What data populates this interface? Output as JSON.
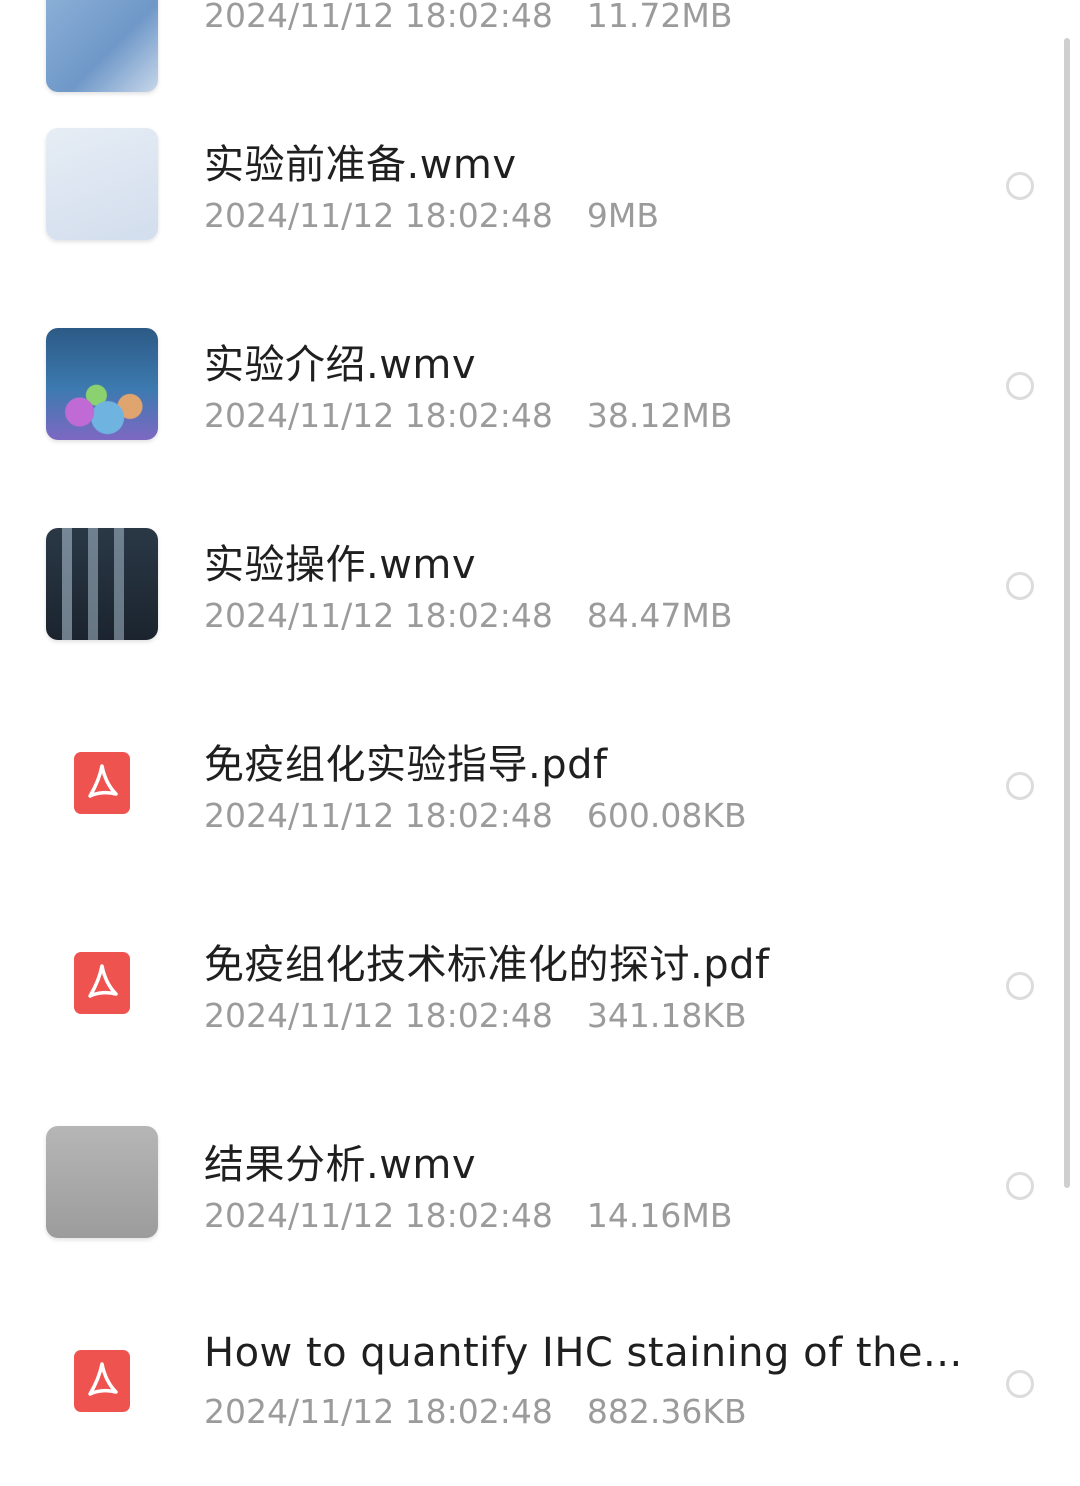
{
  "files": [
    {
      "name": "",
      "date": "2024/11/12 18:02:48",
      "size": "11.72MB",
      "thumb": "video-thumbnail-blue"
    },
    {
      "name": "实验前准备.wmv",
      "date": "2024/11/12 18:02:48",
      "size": "9MB",
      "thumb": "video-thumbnail-light"
    },
    {
      "name": "实验介绍.wmv",
      "date": "2024/11/12 18:02:48",
      "size": "38.12MB",
      "thumb": "video-thumbnail-cells"
    },
    {
      "name": "实验操作.wmv",
      "date": "2024/11/12 18:02:48",
      "size": "84.47MB",
      "thumb": "video-thumbnail-dark"
    },
    {
      "name": "免疫组化实验指导.pdf",
      "date": "2024/11/12 18:02:48",
      "size": "600.08KB",
      "thumb": "pdf-icon"
    },
    {
      "name": "免疫组化技术标准化的探讨.pdf",
      "date": "2024/11/12 18:02:48",
      "size": "341.18KB",
      "thumb": "pdf-icon"
    },
    {
      "name": "结果分析.wmv",
      "date": "2024/11/12 18:02:48",
      "size": "14.16MB",
      "thumb": "video-thumbnail-gray"
    },
    {
      "name": "How to quantify IHC staining of the...",
      "date": "2024/11/12 18:02:48",
      "size": "882.36KB",
      "thumb": "pdf-icon"
    }
  ],
  "colors": {
    "pdf_red": "#ef5350",
    "title_text": "#1f1f1f",
    "meta_text": "#9b9b9b",
    "radio_border": "#dcdcdc"
  }
}
